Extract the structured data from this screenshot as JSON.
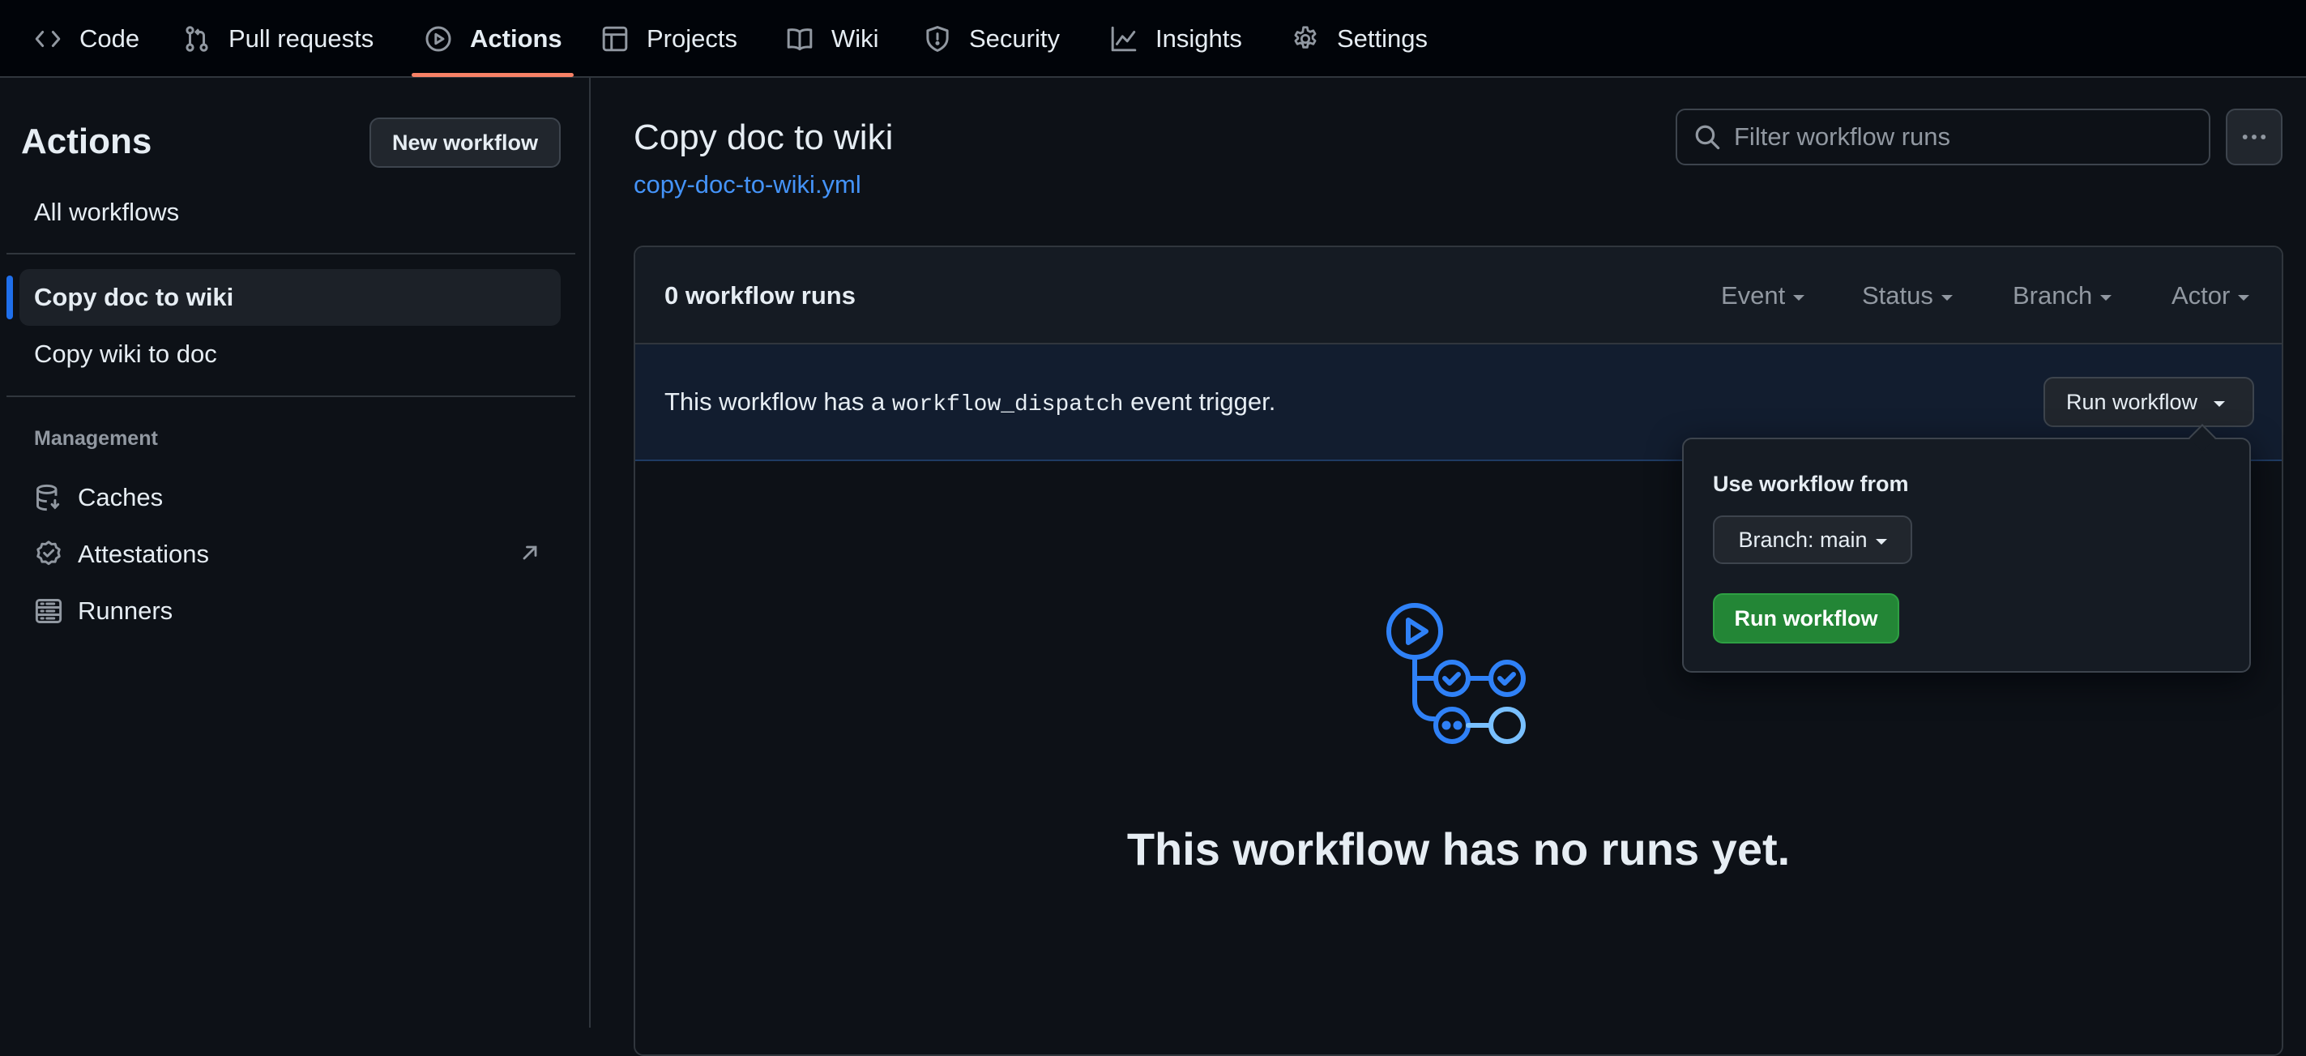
{
  "nav": {
    "tabs": [
      {
        "label": "Code",
        "icon": "code-icon"
      },
      {
        "label": "Pull requests",
        "icon": "git-pull-request-icon"
      },
      {
        "label": "Actions",
        "icon": "play-icon",
        "active": true
      },
      {
        "label": "Projects",
        "icon": "table-icon"
      },
      {
        "label": "Wiki",
        "icon": "book-icon"
      },
      {
        "label": "Security",
        "icon": "shield-icon"
      },
      {
        "label": "Insights",
        "icon": "graph-icon"
      },
      {
        "label": "Settings",
        "icon": "gear-icon"
      }
    ],
    "accent_color": "#f78166"
  },
  "sidebar": {
    "title": "Actions",
    "new_workflow_label": "New workflow",
    "all_workflows_label": "All workflows",
    "workflows": [
      {
        "label": "Copy doc to wiki",
        "selected": true
      },
      {
        "label": "Copy wiki to doc",
        "selected": false
      }
    ],
    "management_heading": "Management",
    "management_items": [
      {
        "label": "Caches",
        "icon": "database-icon"
      },
      {
        "label": "Attestations",
        "icon": "verified-icon",
        "external": true
      },
      {
        "label": "Runners",
        "icon": "server-icon"
      }
    ]
  },
  "main": {
    "title": "Copy doc to wiki",
    "file_link": "copy-doc-to-wiki.yml",
    "filter_placeholder": "Filter workflow runs",
    "runs_count": "0 workflow runs",
    "filters": [
      "Event",
      "Status",
      "Branch",
      "Actor"
    ],
    "banner": {
      "prefix": "This workflow has a ",
      "code": "workflow_dispatch",
      "suffix": " event trigger."
    },
    "run_workflow_label": "Run workflow",
    "empty_message": "This workflow has no runs yet."
  },
  "popover": {
    "label": "Use workflow from",
    "branch_label": "Branch: main",
    "run_button_label": "Run workflow",
    "run_button_color": "#238636"
  },
  "colors": {
    "background": "#0d1117",
    "link": "#4493f8",
    "selected_bar": "#1f6feb"
  }
}
